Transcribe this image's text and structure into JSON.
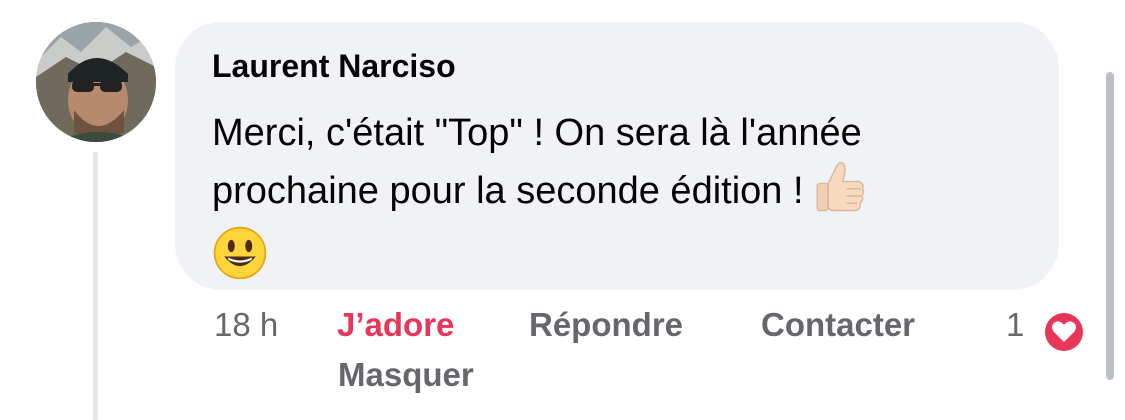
{
  "comment": {
    "author": "Laurent Narciso",
    "text_line1": "Merci,  c'était \"Top\" ! On sera là l'année",
    "text_line2": "prochaine pour la seconde édition !",
    "emojis": [
      "thumbs-up-icon",
      "smiley-face-icon"
    ]
  },
  "actions": {
    "time": "18 h",
    "love_label": "J’adore",
    "reply_label": "Répondre",
    "contact_label": "Contacter",
    "hide_label": "Masquer"
  },
  "reactions": {
    "count": "1",
    "type": "heart-icon",
    "color": "#e8365a"
  },
  "colors": {
    "bubble": "#f0f2f5",
    "secondary_text": "#65676b",
    "love_accent": "#e8365a"
  }
}
